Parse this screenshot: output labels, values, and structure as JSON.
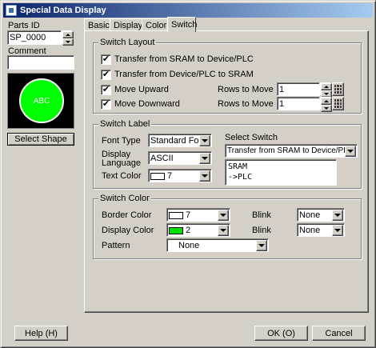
{
  "window": {
    "title": "Special Data Display"
  },
  "left_panel": {
    "parts_id_label": "Parts ID",
    "parts_id_value": "SP_0000",
    "comment_label": "Comment",
    "comment_value": "",
    "preview_text": "ABC",
    "preview_circle_color": "#00ff00",
    "select_shape_label": "Select Shape"
  },
  "tabs": [
    {
      "label": "Basic"
    },
    {
      "label": "Display"
    },
    {
      "label": "Color"
    },
    {
      "label": "Switch",
      "active": true
    }
  ],
  "switch_layout": {
    "title": "Switch Layout",
    "options": [
      {
        "label": "Transfer from SRAM to Device/PLC",
        "checked": true
      },
      {
        "label": "Transfer from Device/PLC to SRAM",
        "checked": true
      },
      {
        "label": "Move Upward",
        "checked": true,
        "rows_label": "Rows to Move",
        "rows_value": "1"
      },
      {
        "label": "Move Downward",
        "checked": true,
        "rows_label": "Rows to Move",
        "rows_value": "1"
      }
    ]
  },
  "switch_label": {
    "title": "Switch Label",
    "font_type_label": "Font Type",
    "font_type_value": "Standard Font",
    "display_language_label_1": "Display",
    "display_language_label_2": "Language",
    "display_language_value": "ASCII",
    "text_color_label": "Text Color",
    "text_color_value": "7",
    "text_color_swatch": "#ffffff",
    "select_switch_label": "Select Switch",
    "select_switch_value": "Transfer from SRAM to Device/PLC",
    "label_text_line1": "SRAM",
    "label_text_line2": "->PLC"
  },
  "switch_color": {
    "title": "Switch Color",
    "border_color_label": "Border Color",
    "border_color_value": "7",
    "border_color_swatch": "#ffffff",
    "border_blink_label": "Blink",
    "border_blink_value": "None",
    "display_color_label": "Display Color",
    "display_color_value": "2",
    "display_color_swatch": "#00e000",
    "display_blink_label": "Blink",
    "display_blink_value": "None",
    "pattern_label": "Pattern",
    "pattern_value": "None"
  },
  "footer": {
    "help_label": "Help (H)",
    "ok_label": "OK (O)",
    "cancel_label": "Cancel"
  },
  "icons": {
    "checkmark": "✔",
    "title_icon": "window-icon"
  }
}
